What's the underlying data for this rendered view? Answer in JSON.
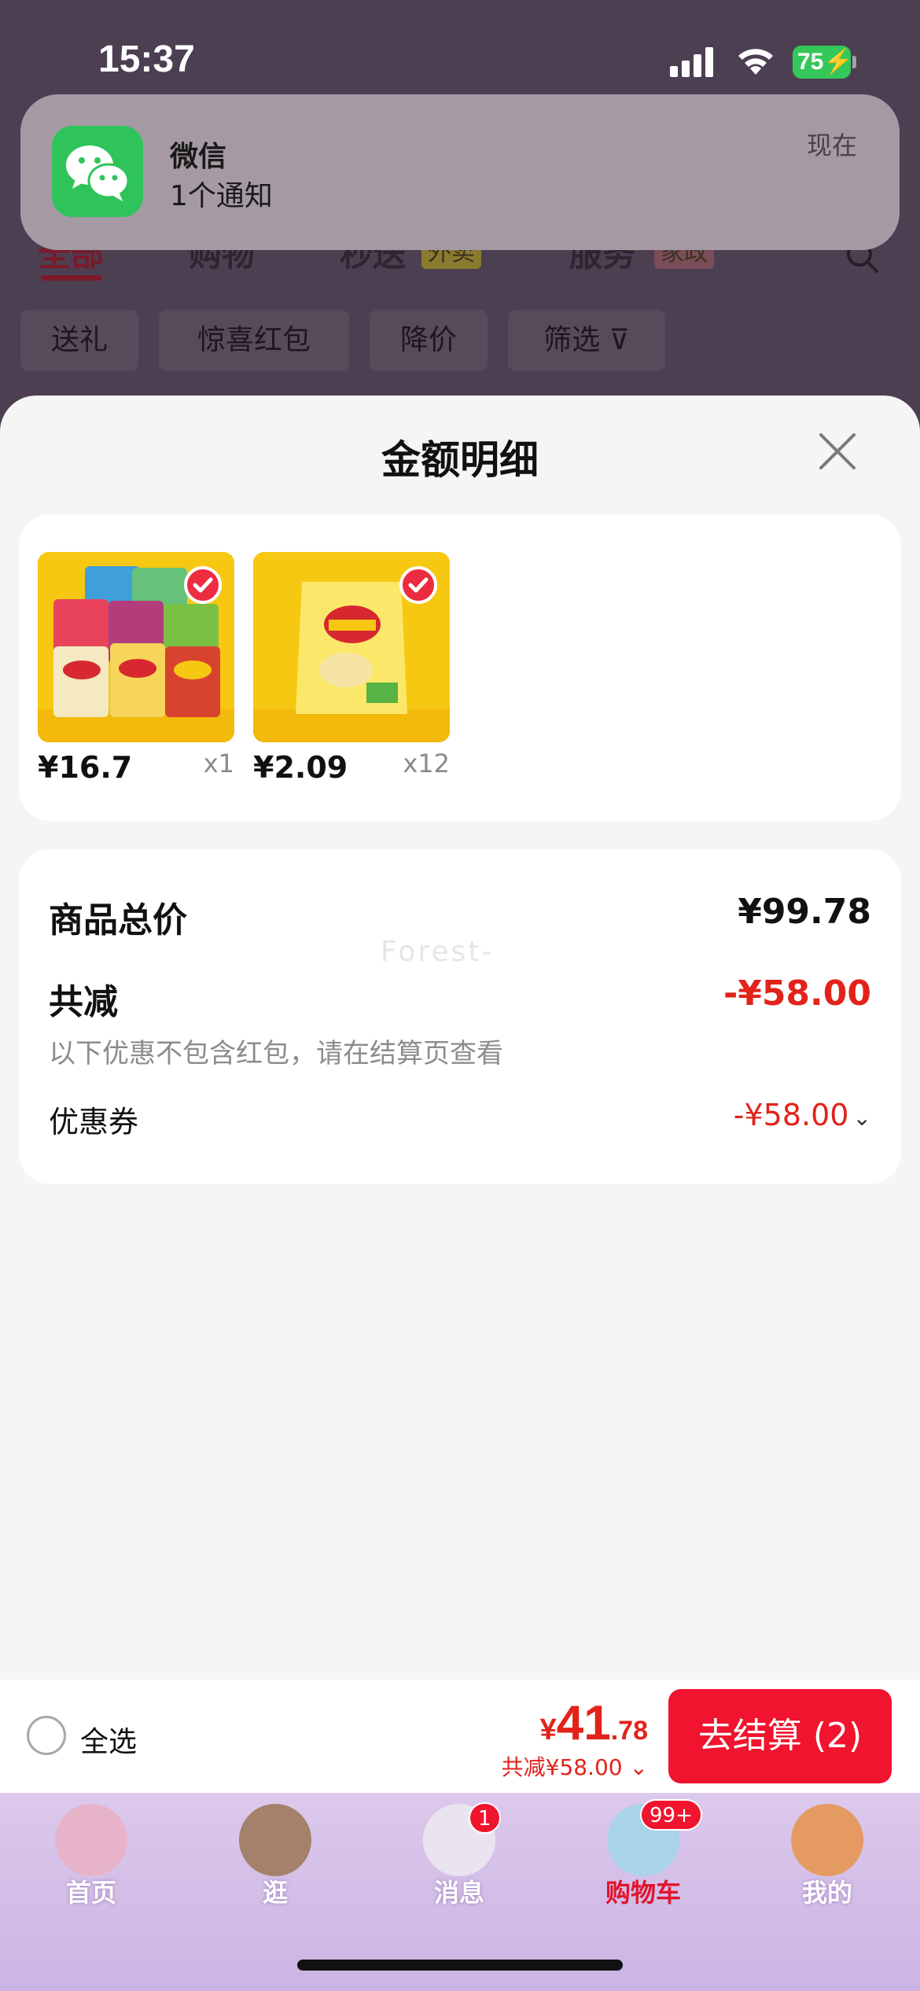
{
  "status_bar": {
    "time": "15:37",
    "battery": "75",
    "icons": [
      "signal-icon",
      "wifi-icon",
      "battery-charging-icon"
    ]
  },
  "notification": {
    "app": "微信",
    "body": "1个通知",
    "time": "现在",
    "icon": "wechat-icon"
  },
  "background_tabs": {
    "tabs": [
      "全部",
      "购物",
      "秒送",
      "服务"
    ],
    "badges": [
      "外卖",
      "家政"
    ],
    "chips": [
      "送礼",
      "惊喜红包",
      "降价",
      "筛选"
    ]
  },
  "sheet": {
    "title": "金额明细",
    "products": [
      {
        "price": "¥16.7",
        "qty": "x1"
      },
      {
        "price": "¥2.09",
        "qty": "x12"
      }
    ],
    "summary": {
      "total_label": "商品总价",
      "total_value": "¥99.78",
      "discount_label": "共减",
      "discount_value": "-¥58.00",
      "note": "以下优惠不包含红包，请在结算页查看",
      "coupon_label": "优惠券",
      "coupon_value": "-¥58.00",
      "watermark": "Forest-"
    }
  },
  "checkout": {
    "select_all": "全选",
    "price_symbol": "¥",
    "price_int": "41",
    "price_dec": ".78",
    "saving": "共减¥58.00",
    "button": "去结算 (2)"
  },
  "tabbar": {
    "items": [
      {
        "label": "首页"
      },
      {
        "label": "逛"
      },
      {
        "label": "消息",
        "badge": "1"
      },
      {
        "label": "购物车",
        "badge": "99+"
      },
      {
        "label": "我的"
      }
    ]
  },
  "colors": {
    "accent_red": "#e2231a",
    "button_red": "#f0142e",
    "wechat_green": "#2fc45b"
  }
}
